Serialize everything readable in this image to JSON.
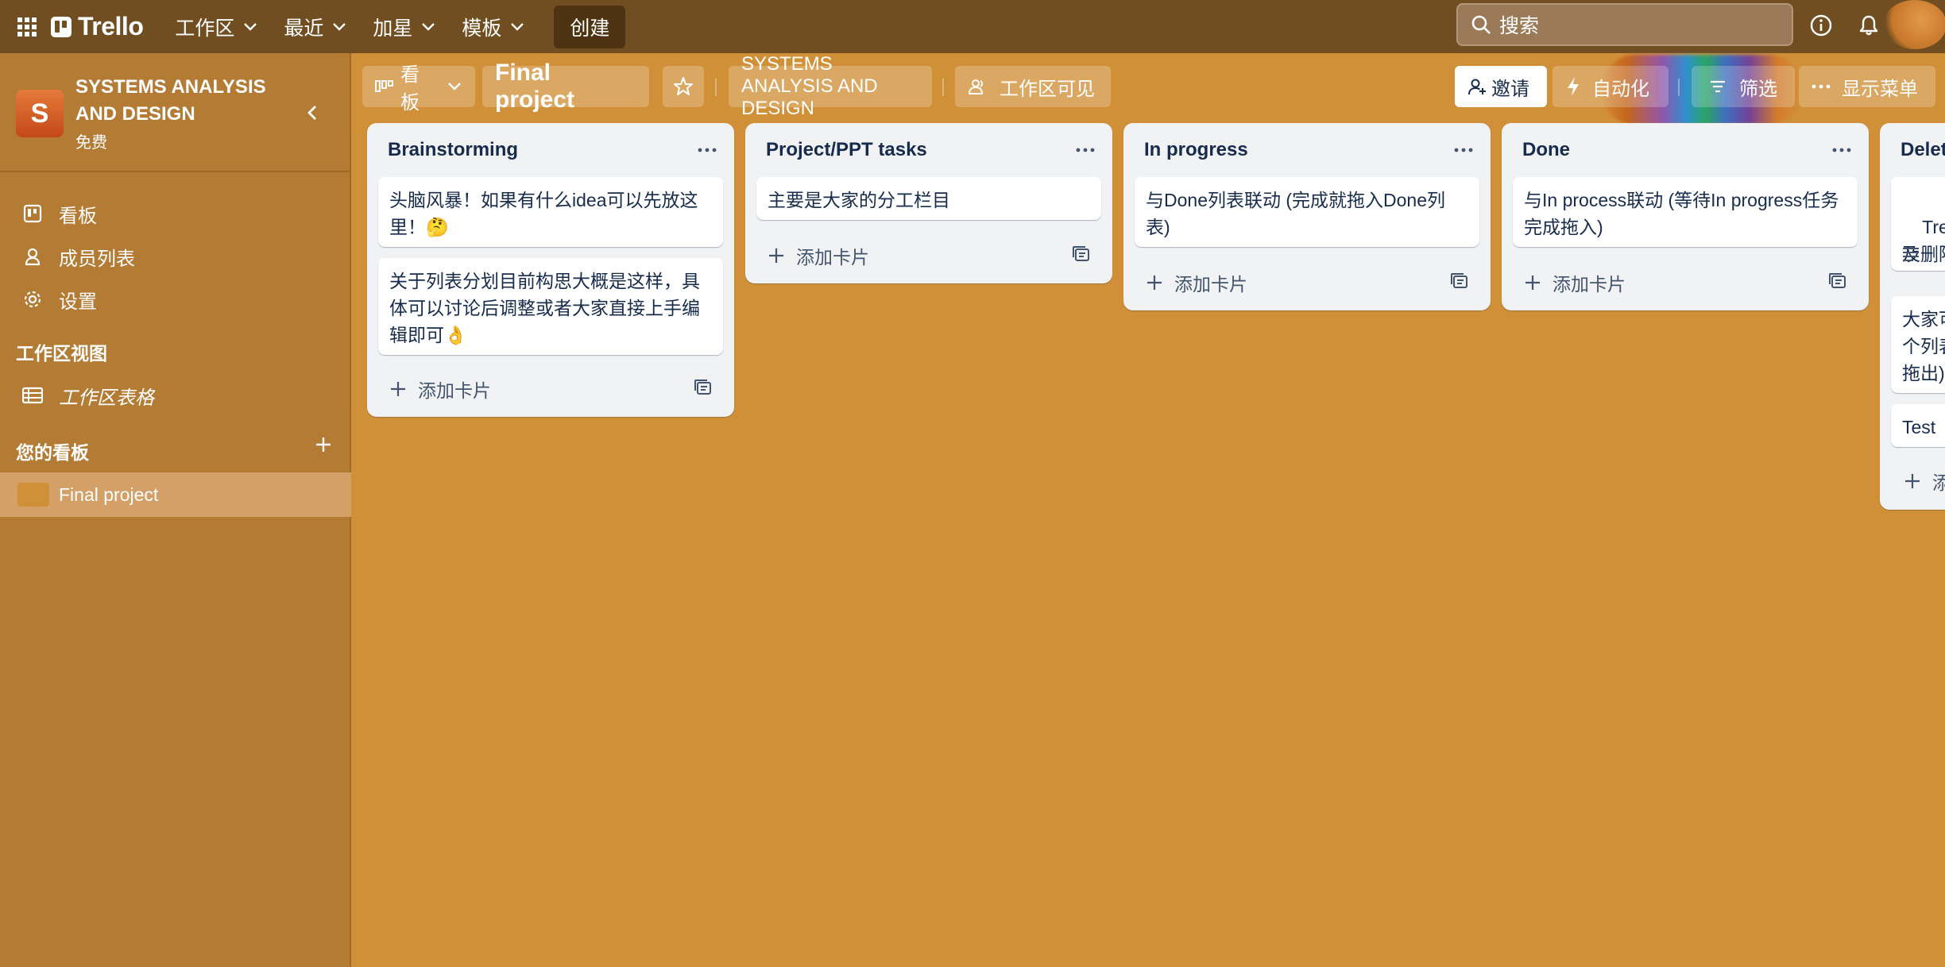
{
  "topbar": {
    "logo": "Trello",
    "menus": [
      "工作区",
      "最近",
      "加星",
      "模板"
    ],
    "create_label": "创建",
    "search_placeholder": "搜索"
  },
  "sidebar": {
    "workspace_initial": "S",
    "workspace_name": "SYSTEMS ANALYSIS AND DESIGN",
    "workspace_plan": "免费",
    "items": [
      {
        "label": "看板",
        "icon": "board-icon"
      },
      {
        "label": "成员列表",
        "icon": "person-icon"
      },
      {
        "label": "设置",
        "icon": "gear-icon"
      }
    ],
    "views_heading": "工作区视图",
    "views": [
      {
        "label": "工作区表格",
        "icon": "table-icon"
      }
    ],
    "boards_heading": "您的看板",
    "boards": [
      {
        "label": "Final project"
      }
    ]
  },
  "board_header": {
    "view_switch": "看板",
    "title": "Final project",
    "workspace_button": "SYSTEMS ANALYSIS AND DESIGN",
    "visibility": "工作区可见",
    "invite": "邀请",
    "automation": "自动化",
    "filter": "筛选",
    "show_menu": "显示菜单"
  },
  "lists": [
    {
      "title": "Brainstorming",
      "cards": [
        "头脑风暴！如果有什么idea可以先放这里！🤔",
        "关于列表分划目前构思大概是这样，具体可以讨论后调整或者大家直接上手编辑即可👌"
      ],
      "add_card": "添加卡片"
    },
    {
      "title": "Project/PPT tasks",
      "cards": [
        "主要是大家的分工栏目"
      ],
      "add_card": "添加卡片"
    },
    {
      "title": "In progress",
      "cards": [
        "与Done列表联动 (完成就拖入Done列表)"
      ],
      "add_card": "添加卡片"
    },
    {
      "title": "Done",
      "cards": [
        "与In process联动 (等待In progress任务完成拖入)"
      ],
      "add_card": "添加卡片"
    },
    {
      "title": "Delet",
      "cards": [
        "Trello\n及删除",
        "大家可\n个列表\n拖出)",
        "Test"
      ],
      "add_card": "添"
    }
  ],
  "colors": {
    "topbar": "#704e22",
    "sidebar": "#b47b34",
    "board_bg": "#d09038",
    "list_bg": "#f1f2f4",
    "create_btn": "#4d3311"
  }
}
